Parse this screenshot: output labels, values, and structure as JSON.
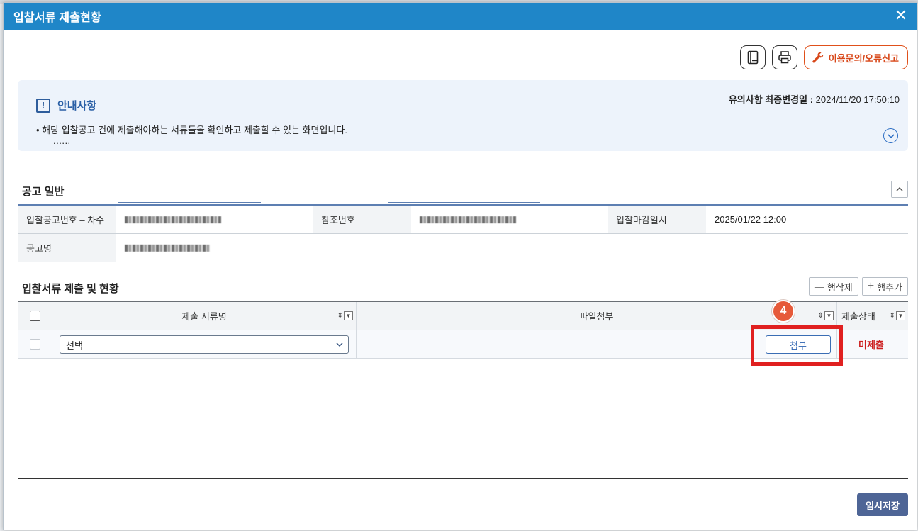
{
  "dialog": {
    "title": "입찰서류 제출현황"
  },
  "toolbar": {
    "report_label": "이용문의/오류신고"
  },
  "notice": {
    "heading": "안내사항",
    "updated_label": "유의사항 최종변경일 :",
    "updated_value": "2024/11/20 17:50:10",
    "line": "• 해당 입찰공고 건에 제출해야하는 서류들을 확인하고 제출할 수 있는 화면입니다.",
    "ellipsis": "......"
  },
  "general": {
    "title": "공고 일반",
    "labels": {
      "bid_no": "입찰공고번호 – 차수",
      "ref_no": "참조번호",
      "deadline": "입찰마감일시",
      "name": "공고명"
    },
    "deadline_value": "2025/01/22 12:00"
  },
  "docs": {
    "title": "입찰서류 제출 및 현황",
    "delete_row": "행삭제",
    "add_row": "행추가",
    "columns": {
      "doc_name": "제출 서류명",
      "file": "파일첨부",
      "status": "제출상태"
    },
    "rows": [
      {
        "select_value": "선택",
        "attach_label": "첨부",
        "status": "미제출"
      }
    ]
  },
  "annotation": {
    "step": "4"
  },
  "footer": {
    "save_label": "임시저장"
  },
  "colors": {
    "title_bar": "#1f86c8",
    "status_unsubmitted": "#cc1f1f",
    "highlight": "#e02020",
    "save_button": "#4e6596"
  }
}
